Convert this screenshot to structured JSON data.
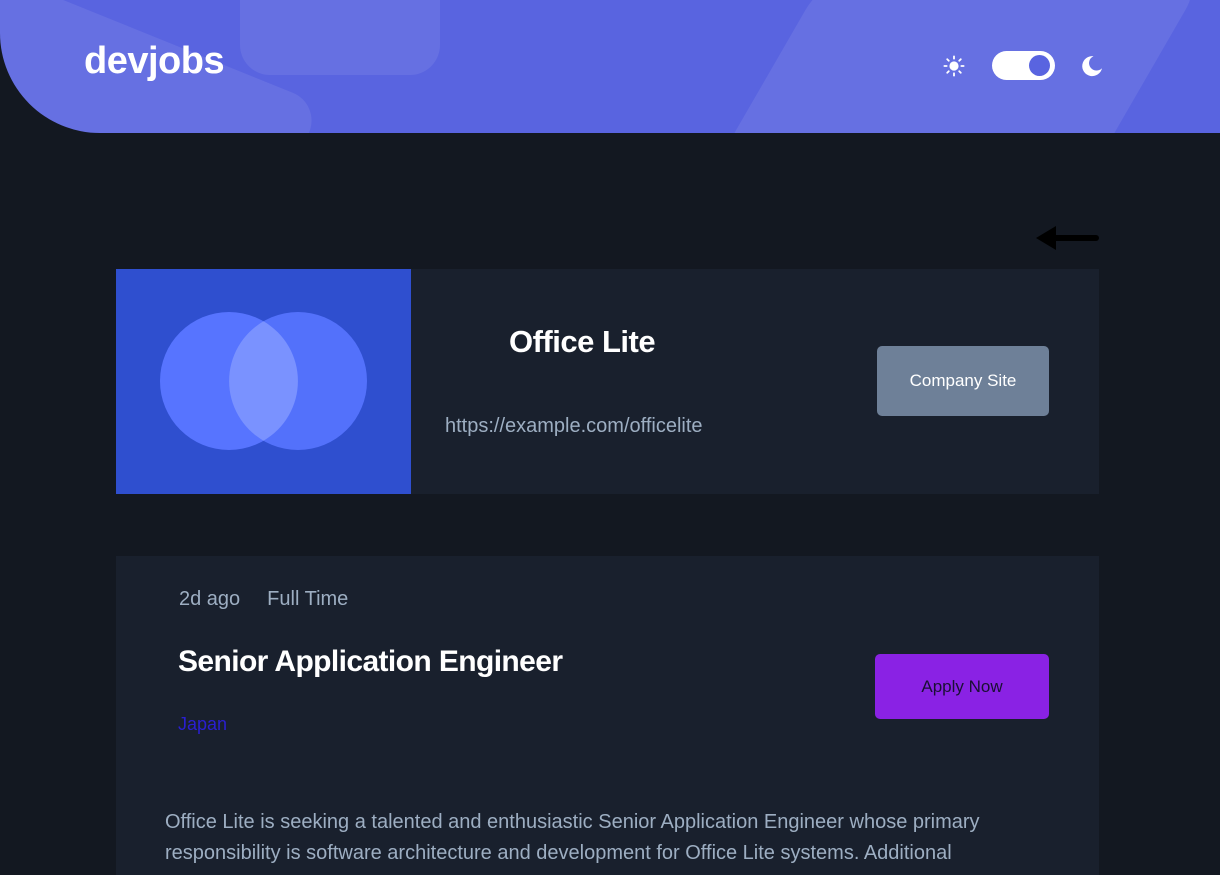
{
  "header": {
    "logo_text": "devjobs",
    "theme": {
      "light_icon": "sun-icon",
      "dark_icon": "moon-icon",
      "mode": "dark"
    }
  },
  "navigation": {
    "back_icon": "arrow-left-icon"
  },
  "company": {
    "name": "Office Lite",
    "url": "https://example.com/officelite",
    "site_button_label": "Company Site",
    "logo_icon": "overlapping-circles-logo"
  },
  "job": {
    "posted_at": "2d ago",
    "contract": "Full Time",
    "position": "Senior Application Engineer",
    "location": "Japan",
    "apply_button_label": "Apply Now",
    "description": "Office Lite is seeking a talented and enthusiastic Senior Application Engineer whose primary responsibility is software architecture and development for Office Lite systems. Additional"
  },
  "colors": {
    "header_bg": "#5964e0",
    "page_bg": "#131821",
    "card_bg": "#19202d",
    "company_logo_bg": "#2f4fcf",
    "company_site_button": "#6e8098",
    "apply_button": "#8a22e4",
    "location_text": "#2a1fd0",
    "muted_text": "#9daec2"
  }
}
